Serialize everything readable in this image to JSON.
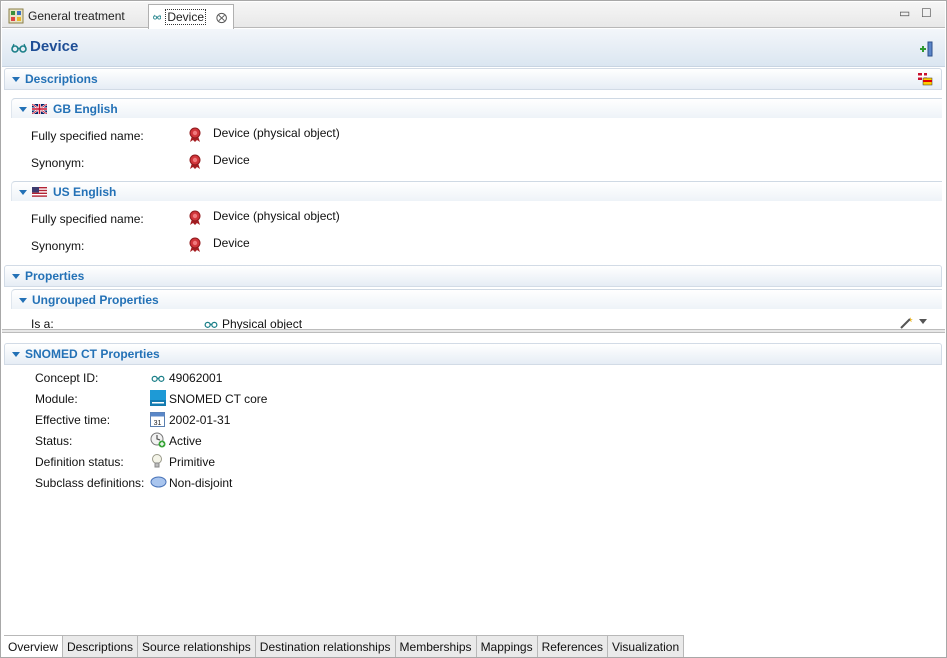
{
  "tabs": {
    "inactive_label": "General treatment",
    "active_label": "Device",
    "close_glyph": "⨂",
    "minimize_glyph": "▭",
    "maximize_glyph": "☐"
  },
  "header": {
    "title": "Device"
  },
  "descriptions": {
    "title": "Descriptions",
    "gb": {
      "title": "GB English",
      "fsn_label": "Fully specified name:",
      "fsn_value": "Device (physical object)",
      "syn_label": "Synonym:",
      "syn_value": "Device"
    },
    "us": {
      "title": "US English",
      "fsn_label": "Fully specified name:",
      "fsn_value": "Device (physical object)",
      "syn_label": "Synonym:",
      "syn_value": "Device"
    }
  },
  "properties": {
    "title": "Properties",
    "ungrouped_title": "Ungrouped Properties",
    "is_a_label": "Is a:",
    "is_a_value": "Physical object"
  },
  "snomed": {
    "title": "SNOMED CT Properties",
    "rows": [
      {
        "label": "Concept ID:",
        "value": "49062001"
      },
      {
        "label": "Module:",
        "value": "SNOMED CT core"
      },
      {
        "label": "Effective time:",
        "value": "2002-01-31"
      },
      {
        "label": "Status:",
        "value": "Active"
      },
      {
        "label": "Definition status:",
        "value": "Primitive"
      },
      {
        "label": "Subclass definitions:",
        "value": "Non-disjoint"
      }
    ],
    "calendar_day": "31"
  },
  "bottom_tabs": [
    "Overview",
    "Descriptions",
    "Source relationships",
    "Destination relationships",
    "Memberships",
    "Mappings",
    "References",
    "Visualization"
  ],
  "colors": {
    "accent": "#2371b6",
    "title": "#1f4e96",
    "ribbon": "#c0292b"
  }
}
